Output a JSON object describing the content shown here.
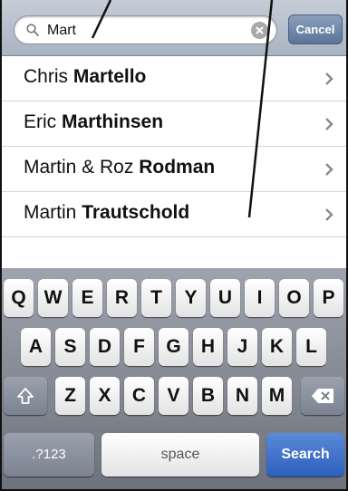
{
  "search": {
    "value": "Mart",
    "cancel_label": "Cancel",
    "icon": "search-icon",
    "clear_icon": "clear-icon"
  },
  "results": [
    {
      "first": "Chris",
      "last": "Martello"
    },
    {
      "first": "Eric",
      "last": "Marthinsen"
    },
    {
      "first": "Martin & Roz",
      "last": "Rodman"
    },
    {
      "first": "Martin",
      "last": "Trautschold"
    }
  ],
  "keyboard": {
    "row1": [
      "Q",
      "W",
      "E",
      "R",
      "T",
      "Y",
      "U",
      "I",
      "O",
      "P"
    ],
    "row2": [
      "A",
      "S",
      "D",
      "F",
      "G",
      "H",
      "J",
      "K",
      "L"
    ],
    "row3": [
      "Z",
      "X",
      "C",
      "V",
      "B",
      "N",
      "M"
    ],
    "shift_icon": "shift-icon",
    "delete_icon": "backspace-icon",
    "numbers_label": ".?123",
    "space_label": "space",
    "search_label": "Search"
  },
  "colors": {
    "search_key": "#2d5fbf",
    "cancel_button": "#5b7496"
  }
}
